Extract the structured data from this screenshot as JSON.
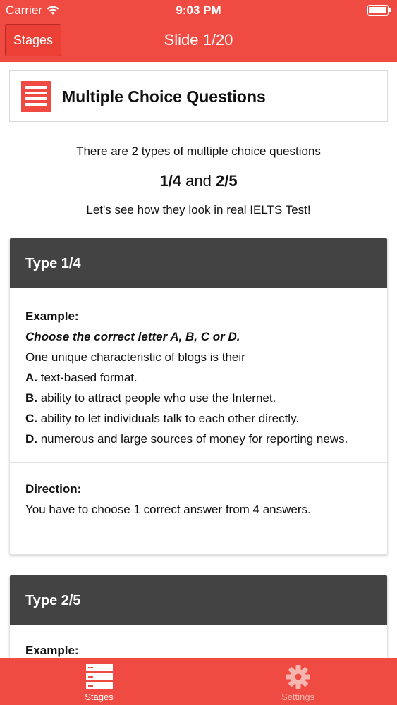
{
  "status_bar": {
    "carrier": "Carrier",
    "time": "9:03 PM"
  },
  "nav": {
    "back_label": "Stages",
    "title": "Slide 1/20"
  },
  "title_card": {
    "title": "Multiple Choice Questions",
    "icon": "list-document-icon"
  },
  "intro": {
    "line1": "There are 2 types of multiple choice questions",
    "types_a": "1/4",
    "types_and": " and ",
    "types_b": "2/5",
    "line3": "Let's see how they look in real IELTS Test!"
  },
  "cards": [
    {
      "header": "Type 1/4",
      "example_label": "Example:",
      "instruction": "Choose the correct letter A, B, C or D.",
      "question": "One unique characteristic of blogs is their",
      "options": [
        {
          "letter": "A.",
          "text": " text-based format."
        },
        {
          "letter": "B.",
          "text": " ability to attract people who use the Internet."
        },
        {
          "letter": "C.",
          "text": " ability to let individuals talk to each other directly."
        },
        {
          "letter": "D.",
          "text": " numerous and large sources of money for reporting news."
        }
      ],
      "direction_label": "Direction:",
      "direction_text": "You have to choose 1 correct answer from 4 answers."
    },
    {
      "header": "Type 2/5",
      "example_label": "Example:"
    }
  ],
  "tabbar": {
    "items": [
      {
        "label": "Stages",
        "icon": "stages-icon",
        "active": true
      },
      {
        "label": "Settings",
        "icon": "gear-icon",
        "active": false
      }
    ]
  },
  "colors": {
    "accent": "#f04b42",
    "card_header": "#444343",
    "tab_inactive": "#f7b5b0"
  }
}
